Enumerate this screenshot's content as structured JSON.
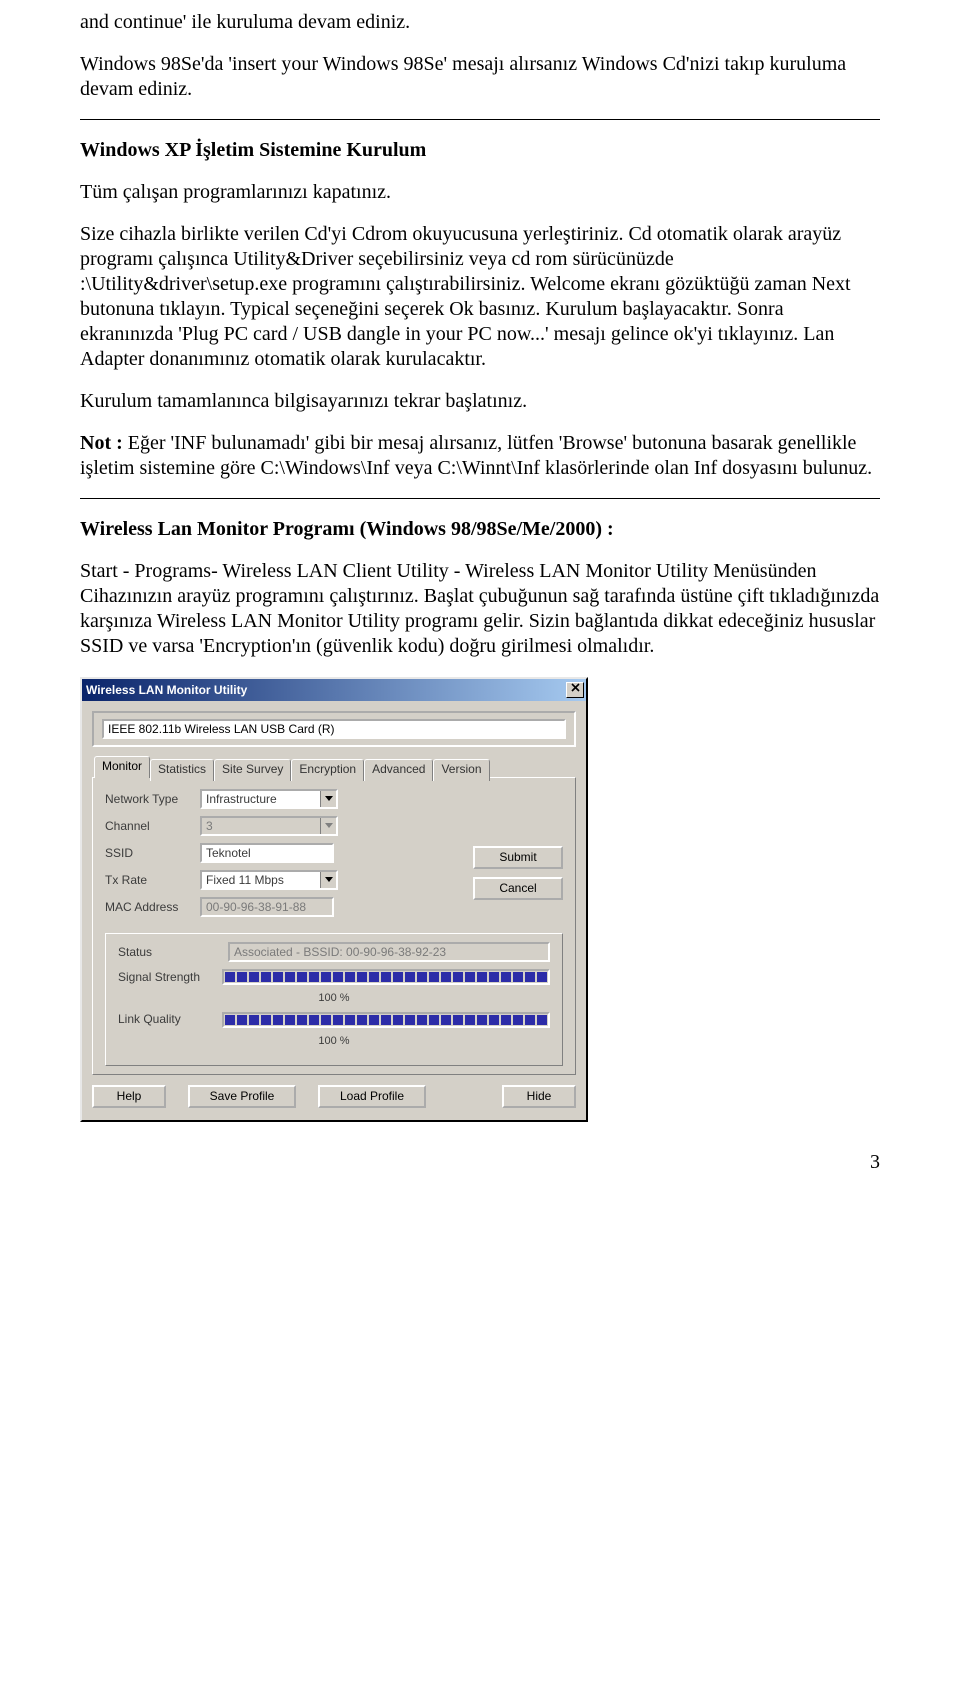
{
  "doc": {
    "p1": "and continue' ile kuruluma devam ediniz.",
    "p2": "Windows 98Se'da 'insert your Windows 98Se' mesajı alırsanız Windows Cd'nizi takıp kuruluma devam ediniz.",
    "h1": "Windows XP İşletim Sistemine Kurulum",
    "p3": "Tüm çalışan programlarınızı kapatınız.",
    "p4": "Size cihazla birlikte verilen Cd'yi Cdrom okuyucusuna yerleştiriniz. Cd otomatik olarak arayüz programı çalışınca Utility&Driver seçebilirsiniz veya cd rom sürücünüzde :\\Utility&driver\\setup.exe programını çalıştırabilirsiniz. Welcome ekranı gözüktüğü zaman Next butonuna tıklayın. Typical seçeneğini seçerek Ok basınız. Kurulum başlayacaktır. Sonra ekranınızda 'Plug PC card / USB dangle in your PC now...' mesajı gelince ok'yi tıklayınız. Lan Adapter donanımınız otomatik olarak kurulacaktır.",
    "p5": "Kurulum tamamlanınca bilgisayarınızı tekrar başlatınız.",
    "p6a": "Not :",
    "p6b": " Eğer 'INF bulunamadı' gibi bir mesaj alırsanız, lütfen 'Browse' butonuna basarak genellikle işletim sistemine göre C:\\Windows\\Inf veya C:\\Winnt\\Inf klasörlerinde olan Inf dosyasını bulunuz.",
    "h2": "Wireless Lan Monitor Programı (Windows 98/98Se/Me/2000) :",
    "p7": "Start - Programs- Wireless LAN Client Utility - Wireless LAN Monitor Utility Menüsünden Cihazınızın arayüz programını çalıştırınız. Başlat çubuğunun sağ tarafında üstüne çift tıkladığınızda karşınıza Wireless LAN Monitor Utility programı gelir. Sizin bağlantıda dikkat edeceğiniz hususlar SSID ve varsa 'Encryption'ın (güvenlik kodu) doğru girilmesi olmalıdır.",
    "page_num": "3"
  },
  "dlg": {
    "title": "Wireless LAN Monitor Utility",
    "card": "IEEE 802.11b Wireless LAN USB Card (R)",
    "tabs": [
      "Monitor",
      "Statistics",
      "Site Survey",
      "Encryption",
      "Advanced",
      "Version"
    ],
    "labels": {
      "network_type": "Network Type",
      "channel": "Channel",
      "ssid": "SSID",
      "tx_rate": "Tx Rate",
      "mac": "MAC Address",
      "status": "Status",
      "signal": "Signal Strength",
      "link": "Link Quality"
    },
    "values": {
      "network_type": "Infrastructure",
      "channel": "3",
      "ssid": "Teknotel",
      "tx_rate": "Fixed 11 Mbps",
      "mac": "00-90-96-38-91-88",
      "status": "Associated - BSSID: 00-90-96-38-92-23",
      "signal_pct": "100 %",
      "link_pct": "100 %"
    },
    "buttons": {
      "submit": "Submit",
      "cancel": "Cancel",
      "help": "Help",
      "save_profile": "Save Profile",
      "load_profile": "Load Profile",
      "hide": "Hide"
    }
  }
}
